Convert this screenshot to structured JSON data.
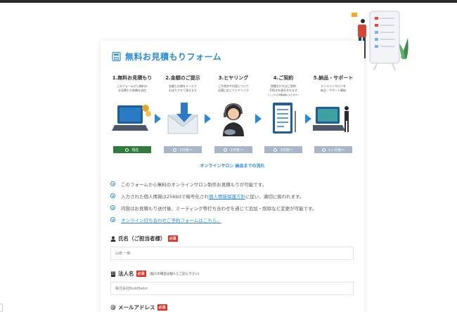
{
  "form": {
    "title": "無料お見積もりフォーム",
    "steps": [
      {
        "title": "1.無料お見積もり",
        "desc1": "このフォームから無料の",
        "desc2": "お見積もり依頼を送信",
        "badge": "現在",
        "current": true
      },
      {
        "title": "2.金額のご提示",
        "desc1": "金額と仕様をメールで",
        "desc2": "お送りさせて頂きます",
        "badge": "1日後～",
        "current": false
      },
      {
        "title": "3.ヒヤリング",
        "desc1": "ご不明点や内容について",
        "desc2": "必要に応じてヒヤリング",
        "badge": "2日後～",
        "current": false
      },
      {
        "title": "4.ご契約",
        "desc1": "問題なければご契約",
        "desc2": "手続きを進めるれます",
        "desc3": "＜ここから作業開始になります＞",
        "badge": "3日後～",
        "current": false
      },
      {
        "title": "5.納品・サポート",
        "desc1": "オンラインサロンを",
        "desc2": "納品・サポート開始",
        "badge": "1ヶ月後～",
        "current": false
      }
    ],
    "flow_caption": "オンラインサロン 納品までの流れ",
    "notes": {
      "n1": "このフォームから無料のオンラインサロン制作お見積もりが可能です。",
      "n2_pre": "入力された個人情報は256bitで暗号化され",
      "n2_link": "個人情報保護方針",
      "n2_post": "に従い、適切に扱われます。",
      "n3": "内容はお見積もり送付後、ミーティング等打ち合わせを通じて追加・削除など変更が可能です。",
      "n4_link": "オンライン打ち合わせご予約フォームはこちら。"
    },
    "fields": {
      "name": {
        "label": "氏名（ご担当者様）",
        "required": "必須",
        "placeholder": "山田 一郎"
      },
      "company": {
        "label": "法人名",
        "required": "必須",
        "sub": "(個人の場合は個人とご記入下さい)",
        "placeholder": "株式会社BuildSalon"
      },
      "email": {
        "label": "メールアドレス",
        "required": "必須"
      }
    }
  },
  "colors": {
    "accent": "#2a8ad4",
    "current_badge": "#2f7a3c",
    "future_badge": "#a8b6c7",
    "required": "#d93025"
  }
}
